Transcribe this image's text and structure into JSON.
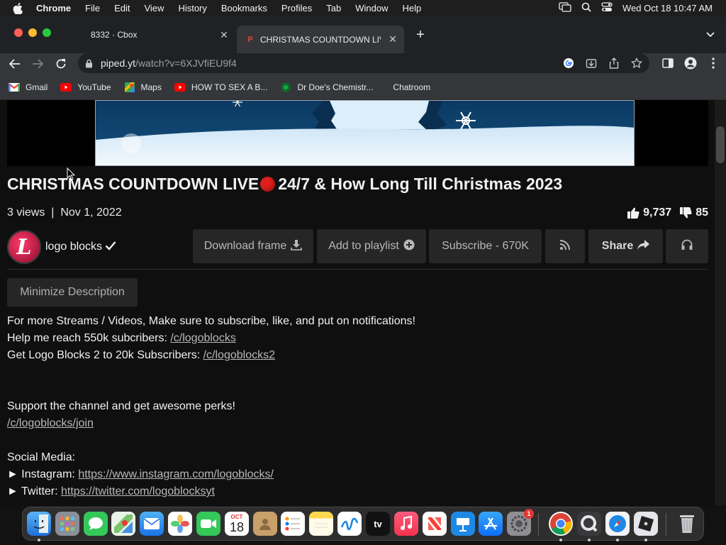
{
  "menubar": {
    "app": "Chrome",
    "items": [
      "File",
      "Edit",
      "View",
      "History",
      "Bookmarks",
      "Profiles",
      "Tab",
      "Window",
      "Help"
    ],
    "clock": "Wed Oct 18  10:47 AM"
  },
  "tabs": [
    {
      "title": "8332 · Cbox"
    },
    {
      "title": "CHRISTMAS COUNTDOWN LIVE",
      "favicon": "P"
    }
  ],
  "omnibox": {
    "host": "piped.yt",
    "path": "/watch?v=6XJVfiEU9f4"
  },
  "bookmarks": [
    {
      "label": "Gmail",
      "icon": "gmail-icon"
    },
    {
      "label": "YouTube",
      "icon": "youtube-icon"
    },
    {
      "label": "Maps",
      "icon": "maps-icon"
    },
    {
      "label": "HOW TO SEX A B...",
      "icon": "youtube-icon"
    },
    {
      "label": "Dr Doe's Chemistr...",
      "icon": "globe-icon"
    },
    {
      "label": "Chatroom",
      "icon": ""
    }
  ],
  "video": {
    "title_part1": "CHRISTMAS COUNTDOWN LIVE",
    "title_part2": "24/7 & How Long Till Christmas 2023",
    "views": "3 views",
    "date": "Nov 1, 2022",
    "likes": "9,737",
    "dislikes": "85"
  },
  "channel": {
    "name": "logo blocks",
    "avatar_letter": "L"
  },
  "actions": {
    "download_frame": "Download frame",
    "add_to_playlist": "Add to playlist",
    "subscribe": "Subscribe - 670K",
    "share": "Share"
  },
  "description": {
    "minimize_label": "Minimize Description",
    "line1": "For more Streams / Videos, Make sure to subscribe, like, and put on notifications!",
    "line2_text": "Help me reach 550k subcribers: ",
    "line2_link": "/c/logoblocks",
    "line3_text": "Get Logo Blocks 2 to 20k Subscribers: ",
    "line3_link": "/c/logoblocks2",
    "line4": "Support the channel and get awesome perks!",
    "line5_link": "/c/logoblocks/join",
    "line6": "Social Media:",
    "line7_text": "► Instagram: ",
    "line7_link": "https://www.instagram.com/logoblocks/",
    "line8_text": "► Twitter: ",
    "line8_link": "https://twitter.com/logoblocksyt"
  },
  "dock": {
    "calendar_month": "OCT",
    "calendar_day": "18",
    "settings_badge": "1",
    "tv_label": "tv"
  }
}
